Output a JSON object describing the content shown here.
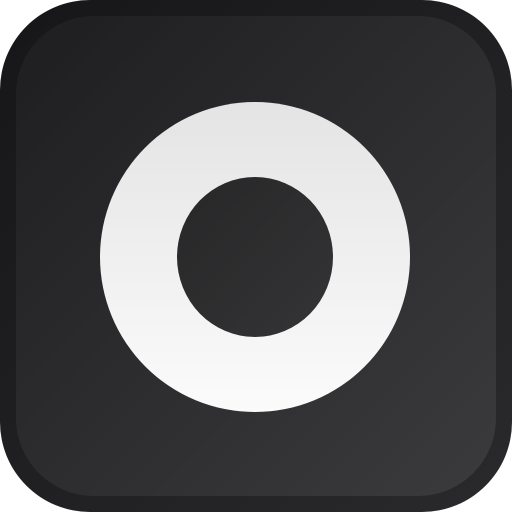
{
  "icon": {
    "name": "ring-icon",
    "colors": {
      "tile_dark": "#1f1f21",
      "tile_light": "#3a3a3c",
      "ring_top": "#e6e6e6",
      "ring_bottom": "#fafafa",
      "hole_top": "#2a2a2b",
      "hole_bottom": "#333335"
    }
  }
}
